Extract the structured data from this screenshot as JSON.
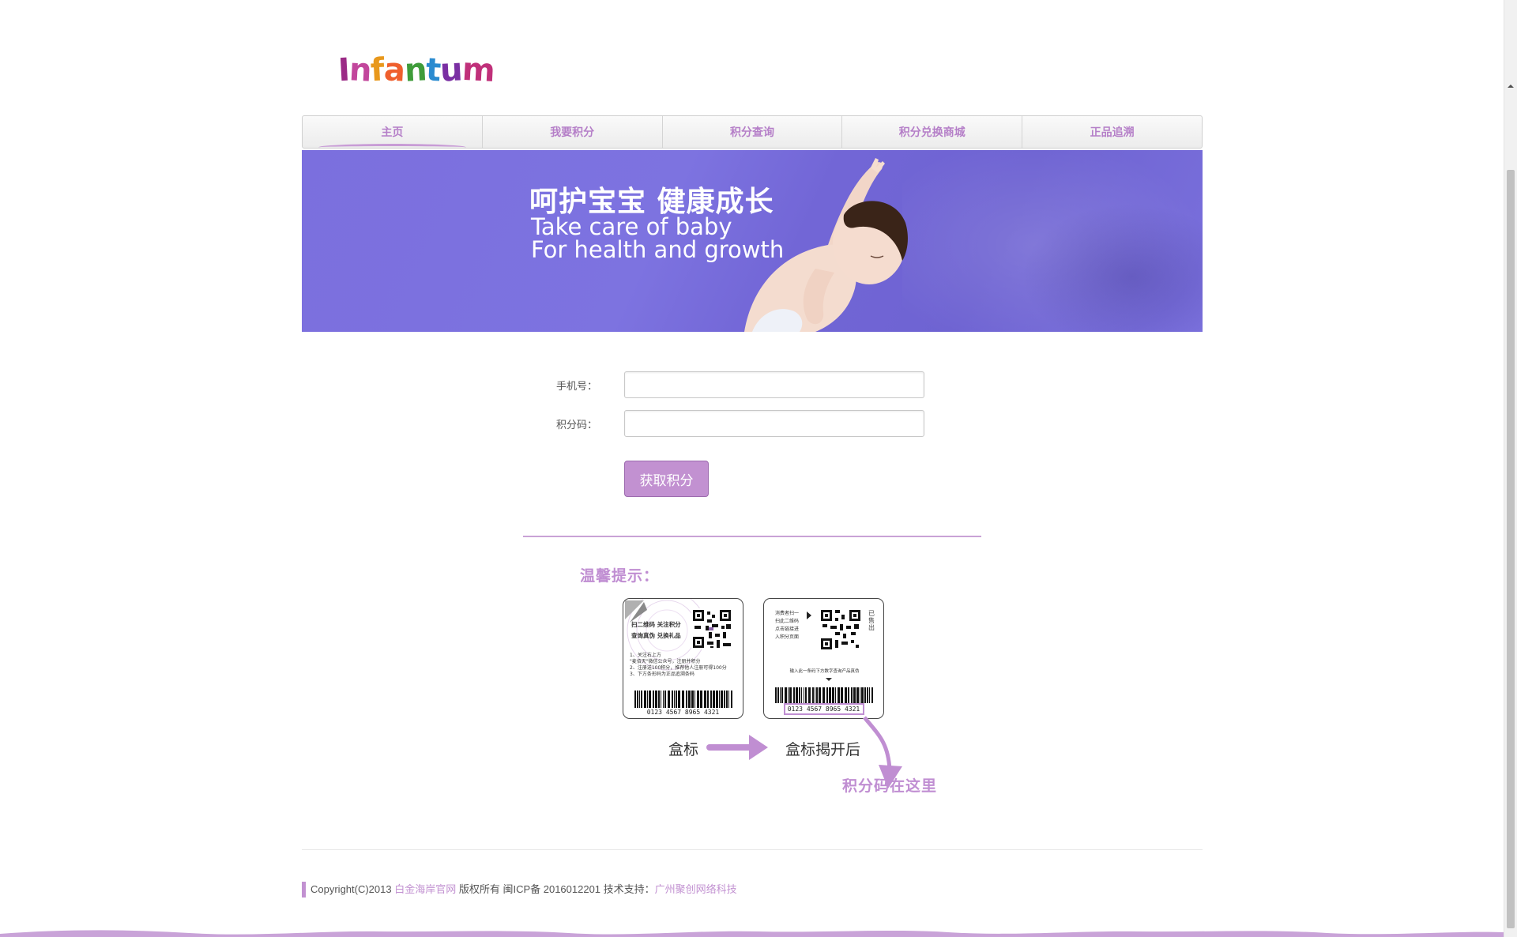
{
  "logo": {
    "text": "Infantum",
    "letters": [
      "I",
      "n",
      "f",
      "a",
      "n",
      "t",
      "u",
      "m"
    ],
    "colors": [
      "#9b2b86",
      "#c2469c",
      "#e8981c",
      "#ef5f2d",
      "#3f9c3a",
      "#2a8bd0",
      "#7a2fa3",
      "#c0307a"
    ]
  },
  "nav": {
    "items": [
      {
        "label": "主页"
      },
      {
        "label": "我要积分"
      },
      {
        "label": "积分查询"
      },
      {
        "label": "积分兑换商城"
      },
      {
        "label": "正品追溯"
      }
    ]
  },
  "banner": {
    "cn": "呵护宝宝  健康成长",
    "en_line1": "Take care of baby",
    "en_line2": "For health and growth"
  },
  "form": {
    "phone_label": "手机号：",
    "code_label": "积分码：",
    "phone_value": "",
    "code_value": "",
    "submit_label": "获取积分"
  },
  "tips": {
    "title": "温馨提示：",
    "card1": {
      "heading1": "扫二维码 关注积分",
      "heading2": "查询真伪 兑换礼品",
      "lines": [
        "1、关注右上方",
        "\"麦佰天\"微信公众号，注册并积分",
        "2、注册送100积分，推荐他人注册可得100分",
        "3、下方条形码为正品追溯条码"
      ],
      "barcode": "0123 4567 8965 4321"
    },
    "card2": {
      "lines": [
        "消费者扫一",
        "扫此二维码",
        "点击链接进",
        "入积分页面"
      ],
      "side": "已售出",
      "instruction": "输入此一条码下方数字查询产品真伪",
      "barcode": "0123 4567 8965 4321"
    },
    "caption_box": "盒标",
    "caption_opened": "盒标揭开后",
    "caption_code": "积分码在这里"
  },
  "footer": {
    "prefix": "Copyright(C)2013 ",
    "link1": "白金海岸官网",
    "middle": " 版权所有 闽ICP备 2016012201 技术支持：",
    "link2": "广州聚创网络科技"
  },
  "colors": {
    "accent": "#c291d1",
    "banner": "#7b6fde",
    "text": "#555555"
  }
}
